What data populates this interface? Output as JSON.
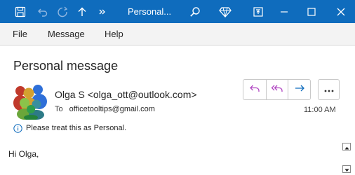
{
  "titlebar": {
    "title": "Personal...",
    "icons": [
      "save-icon",
      "undo-icon",
      "redo-icon",
      "up-arrow-icon",
      "more-commands-icon",
      "search-icon",
      "premium-diamond-icon",
      "restore-window-icon",
      "minimize-icon",
      "maximize-icon",
      "close-icon"
    ],
    "colors": {
      "background": "#0f6cbd",
      "text": "#ffffff"
    }
  },
  "ribbon": {
    "tabs": [
      {
        "label": "File"
      },
      {
        "label": "Message"
      },
      {
        "label": "Help"
      }
    ]
  },
  "message": {
    "subject": "Personal message",
    "sender": "Olga S <olga_ott@outlook.com>",
    "to_label": "To",
    "recipient": "officetooltips@gmail.com",
    "time": "11:00 AM",
    "sensitivity_notice": "Please treat this as Personal.",
    "body_greeting": "Hi Olga,",
    "avatar_icon": "people-group-avatar-icon"
  },
  "actions": {
    "buttons": [
      "reply-icon",
      "reply-all-icon",
      "forward-icon"
    ],
    "more_icon": "more-options-icon",
    "colors": {
      "reply": "#b146c2",
      "forward": "#0f6cbd"
    }
  },
  "scrollbar": {
    "up_icon": "scroll-up-arrow-icon",
    "down_icon": "scroll-down-arrow-icon"
  }
}
